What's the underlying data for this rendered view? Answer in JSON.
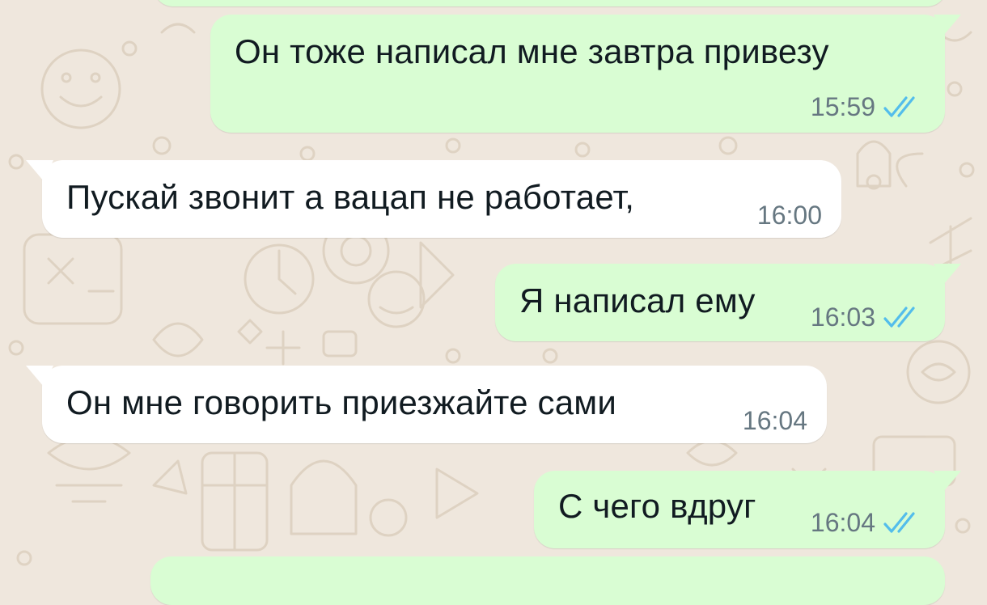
{
  "messages": [
    {
      "direction": "out",
      "text": "Он тоже написал мне завтра привезу",
      "time": "15:59",
      "status_icon": "double-check-read-icon"
    },
    {
      "direction": "in",
      "text": "Пускай звонит а вацап не работает,",
      "time": "16:00"
    },
    {
      "direction": "out",
      "text": "Я написал ему",
      "time": "16:03",
      "status_icon": "double-check-read-icon"
    },
    {
      "direction": "in",
      "text": "Он мне говорить приезжайте сами",
      "time": "16:04"
    },
    {
      "direction": "out",
      "text": "С чего вдруг",
      "time": "16:04",
      "status_icon": "double-check-read-icon"
    }
  ],
  "colors": {
    "background": "#efe7dd",
    "outgoing_bubble": "#d9fdd3",
    "incoming_bubble": "#ffffff",
    "read_ticks": "#53bdeb",
    "time_text": "#667781",
    "message_text": "#111b21"
  }
}
